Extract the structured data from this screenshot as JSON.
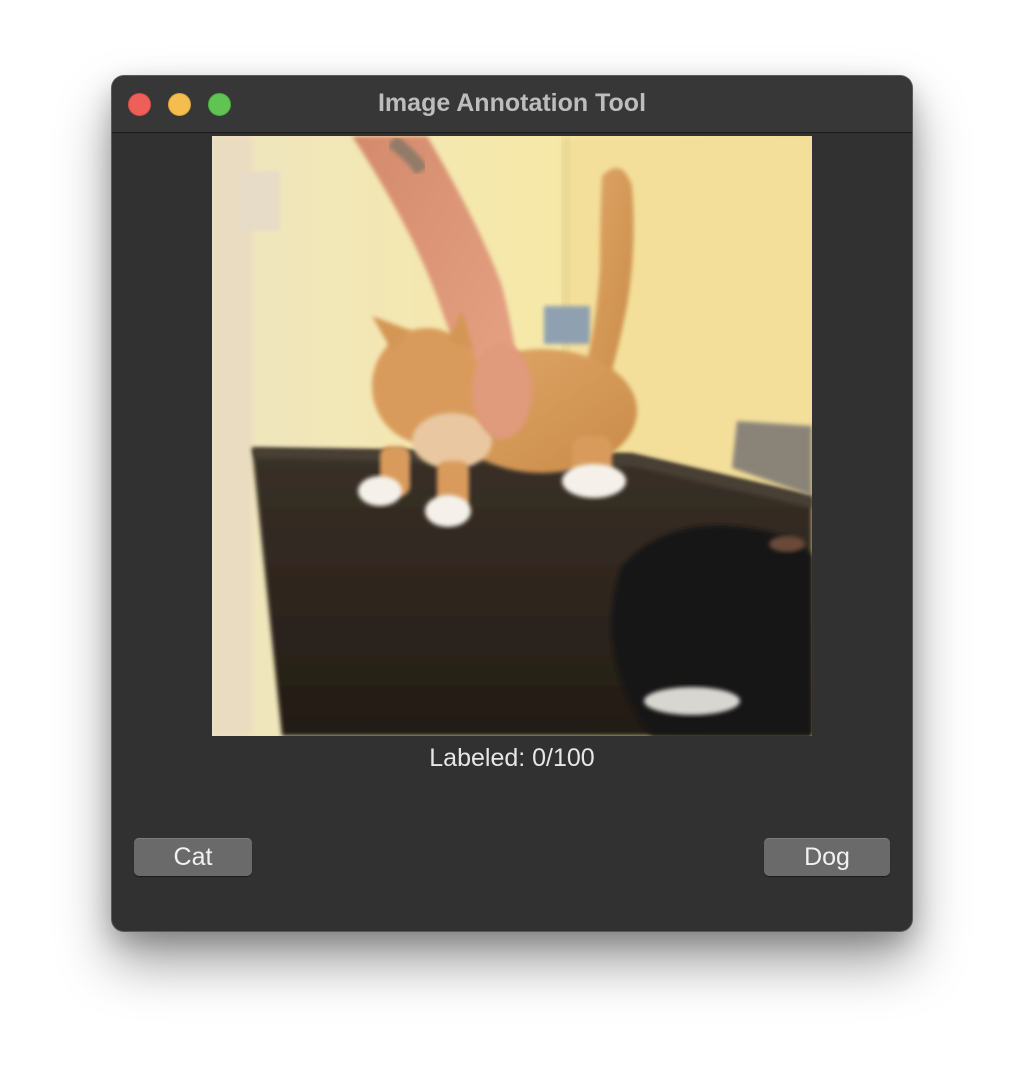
{
  "window": {
    "title": "Image Annotation Tool"
  },
  "image": {
    "alt": "Orange tabby cat being petted on a dark table, black dog in foreground",
    "subject_icon": "photo-cat"
  },
  "status": {
    "labeled_text": "Labeled: 0/100"
  },
  "buttons": {
    "cat_label": "Cat",
    "dog_label": "Dog"
  },
  "colors": {
    "window_bg": "#313131",
    "close": "#ee5f58",
    "minimize": "#f5bd4f",
    "zoom": "#5fc454",
    "button_bg": "#6a6a6a"
  }
}
